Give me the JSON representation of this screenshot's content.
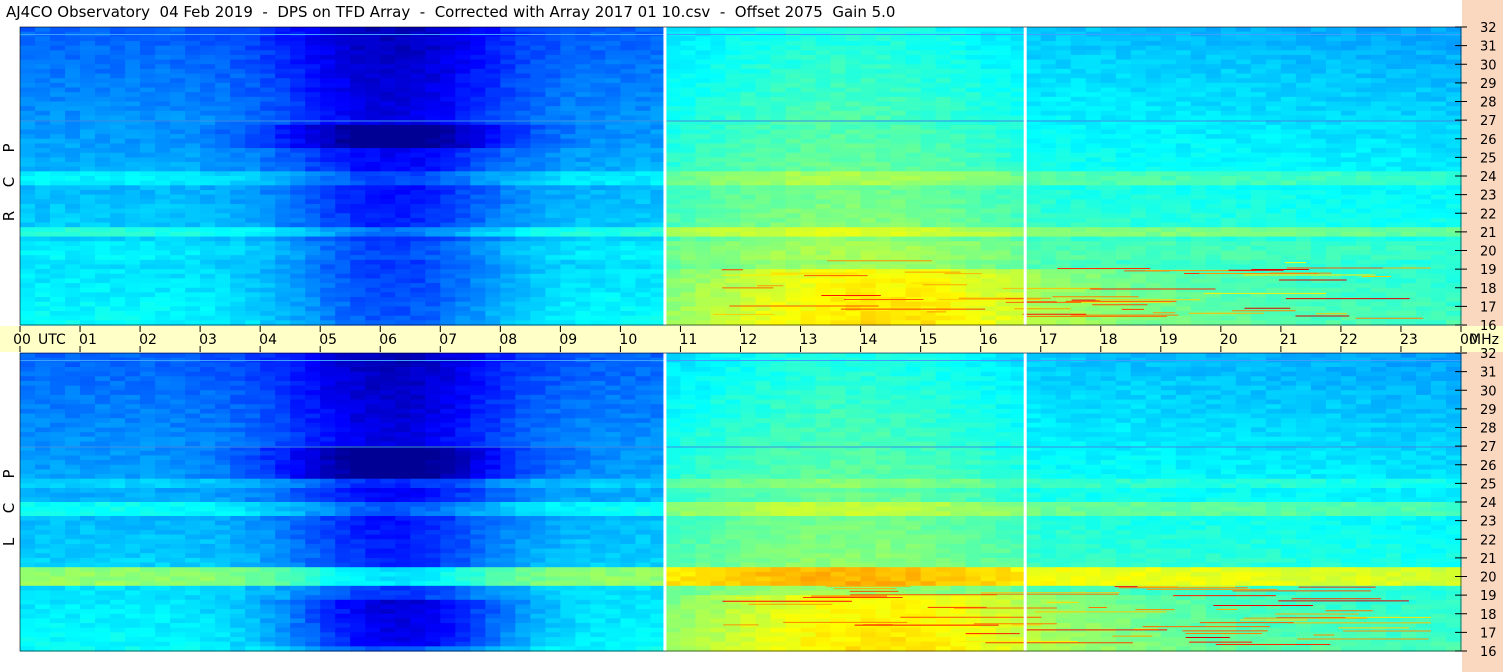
{
  "title": "AJ4CO Observatory  04 Feb 2019  -  DPS on TFD Array  -  Corrected with Array 2017 01 10.csv  -  Offset 2075  Gain 5.0",
  "colors": {
    "background": "#ffffff",
    "axis_band": "#ffffc8",
    "right_strip": "#fad7bf",
    "divider": "#ffffff"
  },
  "chart_data": [
    {
      "type": "heatmap",
      "panel": "upper",
      "polarization_letters": [
        "R",
        "C",
        "P"
      ],
      "y_ticks": [
        "32",
        "31",
        "30",
        "29",
        "28",
        "27",
        "26",
        "25",
        "24",
        "23",
        "22",
        "21",
        "20",
        "19",
        "18",
        "17",
        "16"
      ],
      "ylim": [
        16,
        32
      ],
      "x_ticks": [
        "00",
        "01",
        "02",
        "03",
        "04",
        "05",
        "06",
        "07",
        "08",
        "09",
        "10",
        "11",
        "12",
        "13",
        "14",
        "15",
        "16",
        "17",
        "18",
        "19",
        "20",
        "21",
        "22",
        "23",
        "00"
      ],
      "x_unit_left": "UTC",
      "y_unit": "MHz",
      "xlim": [
        0,
        24
      ],
      "dividers_utc": [
        10.75,
        16.75
      ]
    },
    {
      "type": "heatmap",
      "panel": "lower",
      "polarization_letters": [
        "L",
        "C",
        "P"
      ],
      "y_ticks": [
        "32",
        "31",
        "30",
        "29",
        "28",
        "27",
        "26",
        "25",
        "24",
        "23",
        "22",
        "21",
        "20",
        "19",
        "18",
        "17",
        "16"
      ],
      "ylim": [
        16,
        32
      ],
      "xlim": [
        0,
        24
      ],
      "dividers_utc": [
        10.75,
        16.75
      ]
    }
  ]
}
